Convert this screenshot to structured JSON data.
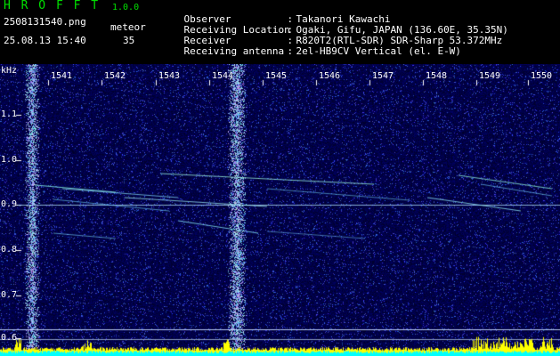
{
  "app": {
    "title": "H R O F F T",
    "version": "1.0.0"
  },
  "capture": {
    "filename": "2508131540.png",
    "datetime": "25.08.13 15:40",
    "meteor_label": "meteor",
    "meteor_count": "35"
  },
  "station": {
    "rows": [
      {
        "key": "Observer",
        "value": "Takanori Kawachi"
      },
      {
        "key": "Receiving Location",
        "value": "Ogaki, Gifu, JAPAN (136.60E, 35.35N)"
      },
      {
        "key": "Receiver",
        "value": "R820T2(RTL-SDR) SDR-Sharp 53.372MHz"
      },
      {
        "key": "Receiving antenna",
        "value": "2el-HB9CV Vertical (el. E-W)"
      }
    ]
  },
  "chart_data": {
    "type": "heatmap",
    "unit_label": "kHz",
    "x_ticks": [
      "1541",
      "1542",
      "1543",
      "1544",
      "1545",
      "1546",
      "1547",
      "1548",
      "1549",
      "1550"
    ],
    "y_ticks": [
      "1.1",
      "1.0",
      "0.9",
      "0.8",
      "0.7",
      "0.6"
    ],
    "ylim": [
      0.57,
      1.17
    ],
    "colors": {
      "background": "#00002a",
      "noise": "#1a2aa0",
      "trace": "#a0ffff",
      "baseline": "#00ffff",
      "peaks": "#ffff00"
    }
  }
}
